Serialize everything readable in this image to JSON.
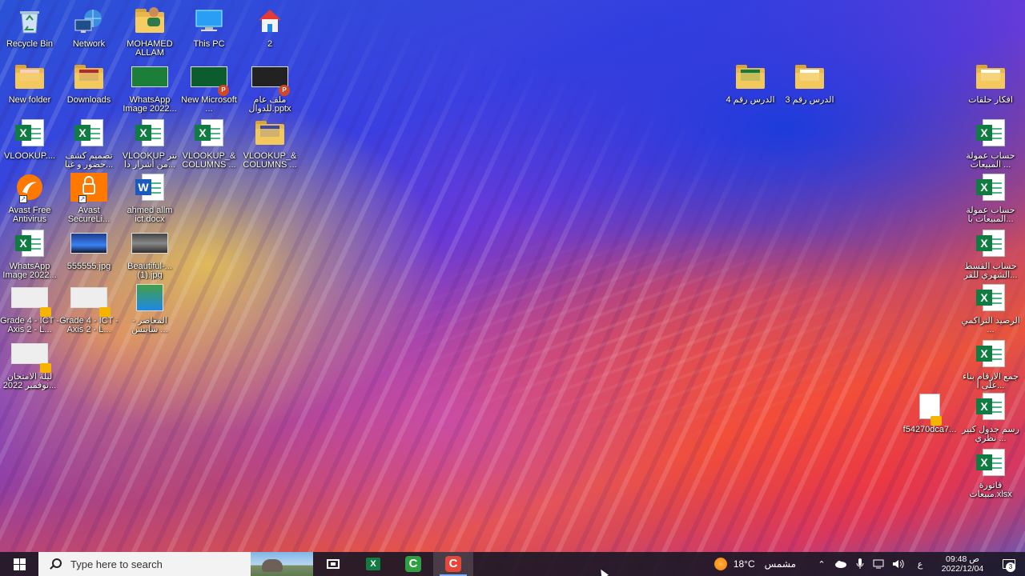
{
  "desktop": {
    "icons": [
      {
        "label": "Recycle Bin",
        "type": "recycle"
      },
      {
        "label": "Network",
        "type": "network"
      },
      {
        "label": "MOHAMED ALLAM",
        "type": "user-folder"
      },
      {
        "label": "This PC",
        "type": "pc"
      },
      {
        "label": "2",
        "type": "home"
      },
      {
        "label": "New folder",
        "type": "folder"
      },
      {
        "label": "Downloads",
        "type": "folder"
      },
      {
        "label": "WhatsApp Image 2022...",
        "type": "image"
      },
      {
        "label": "New Microsoft ...",
        "type": "ppt"
      },
      {
        "label": "ملف عام للدوال.pptx",
        "type": "ppt"
      },
      {
        "label": "VLOOKUP....",
        "type": "excel"
      },
      {
        "label": "تصميم كشف حضور و غيا...",
        "type": "excel"
      },
      {
        "label": "VLOOKUP نتر من أشرار دا...",
        "type": "excel"
      },
      {
        "label": "VLOOKUP_& COLUMNS ...",
        "type": "excel"
      },
      {
        "label": "VLOOKUP_& COLUMNS ...",
        "type": "archive"
      },
      {
        "label": "Avast Free Antivirus",
        "type": "avast"
      },
      {
        "label": "Avast SecureLi...",
        "type": "avast-vpn"
      },
      {
        "label": "ahmed allm ict.docx",
        "type": "word"
      },
      {
        "label": "WhatsApp Image 2022...",
        "type": "excel"
      },
      {
        "label": "555555.jpg",
        "type": "image"
      },
      {
        "label": "Beautiful-... (1).jpg",
        "type": "image"
      },
      {
        "label": "Grade 4 - ICT - Axis 2 - L...",
        "type": "video"
      },
      {
        "label": "Grade 4 - ICT - Axis 2 - L...",
        "type": "video"
      },
      {
        "label": "المعاصر - سايتس ...",
        "type": "app"
      },
      {
        "label": "ليلة الامتحان نوفمبر 2022...",
        "type": "video"
      },
      {
        "label": "الدرس رقم 4",
        "type": "excel-folder"
      },
      {
        "label": "الدرس رقم 3",
        "type": "folder"
      },
      {
        "label": "افكار حلقات",
        "type": "folder"
      },
      {
        "label": "حساب عمولة المبيعات ...",
        "type": "excel"
      },
      {
        "label": "حساب عمولة المبيعات با...",
        "type": "excel"
      },
      {
        "label": "حساب القسط الشهري للقر...",
        "type": "excel"
      },
      {
        "label": "الرصيد التراكمي ...",
        "type": "excel"
      },
      {
        "label": "جمع الارقام بناء على ا...",
        "type": "excel"
      },
      {
        "label": "f54270dca7...",
        "type": "video-file"
      },
      {
        "label": "رسم جدول كبير نظري ...",
        "type": "excel"
      },
      {
        "label": "فاتورة مبيعات.xlsx",
        "type": "excel"
      }
    ]
  },
  "taskbar": {
    "search_placeholder": "Type here to search",
    "weather_temp": "18°C",
    "weather_desc": "مشمس",
    "language": "ع",
    "time": "09:48 ص",
    "date": "2022/12/04",
    "notification_count": "3"
  }
}
